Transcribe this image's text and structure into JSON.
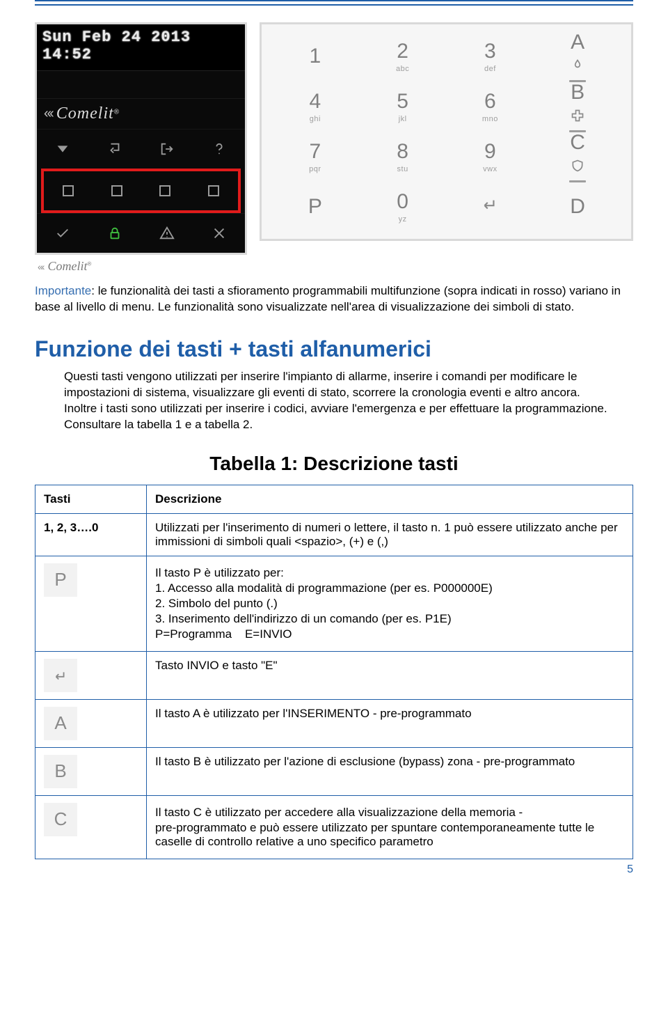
{
  "page_number": "5",
  "lcd": {
    "datetime": "Sun Feb 24 2013 14:52",
    "brand": "Comelit"
  },
  "keypad": {
    "rows": [
      [
        {
          "main": "1",
          "sub": ""
        },
        {
          "main": "2",
          "sub": "abc"
        },
        {
          "main": "3",
          "sub": "def"
        },
        {
          "main": "A",
          "sub": ""
        }
      ],
      [
        {
          "main": "4",
          "sub": "ghi"
        },
        {
          "main": "5",
          "sub": "jkl"
        },
        {
          "main": "6",
          "sub": "mno"
        },
        {
          "main": "B",
          "sub": ""
        }
      ],
      [
        {
          "main": "7",
          "sub": "pqr"
        },
        {
          "main": "8",
          "sub": "stu"
        },
        {
          "main": "9",
          "sub": "vwx"
        },
        {
          "main": "C",
          "sub": ""
        }
      ],
      [
        {
          "main": "P",
          "sub": ""
        },
        {
          "main": "0",
          "sub": "yz"
        },
        {
          "main": "↵",
          "sub": ""
        },
        {
          "main": "D",
          "sub": ""
        }
      ]
    ],
    "side_icons": [
      "fire-icon",
      "bar-icon",
      "medical-icon",
      "bar-icon",
      "shield-icon",
      "bar-icon"
    ]
  },
  "important": {
    "lead": "Importante",
    "text": ": le funzionalità dei tasti a sfioramento programmabili multifunzione (sopra indicati in rosso) variano in base al livello di menu. Le funzionalità sono visualizzate nell'area di visualizzazione dei simboli di stato."
  },
  "section_heading": "Funzione dei tasti + tasti alfanumerici",
  "section_body": "Questi tasti vengono utilizzati per inserire l'impianto di allarme, inserire i comandi per modificare le impostazioni di sistema, visualizzare gli eventi di stato, scorrere la cronologia eventi e altro ancora.\nInoltre i tasti sono utilizzati per inserire i codici, avviare l'emergenza e per effettuare la programmazione. Consultare la tabella 1 e a tabella 2.",
  "table": {
    "title": "Tabella 1: Descrizione tasti",
    "headers": {
      "key": "Tasti",
      "desc": "Descrizione"
    },
    "rows": [
      {
        "key_label": "1, 2, 3….0",
        "key_type": "text",
        "desc": "Utilizzati per l'inserimento di numeri o lettere, il tasto n. 1 può essere utilizzato anche per immissioni di simboli quali <spazio>, (+) e (,)"
      },
      {
        "key_label": "P",
        "key_type": "cap",
        "desc_lines": [
          "Il tasto P è utilizzato per:",
          "1. Accesso alla modalità di programmazione (per es. P000000E)",
          "2. Simbolo del punto (.)",
          "3. Inserimento dell'indirizzo di un comando (per es. P1E)",
          "P=Programma    E=INVIO"
        ]
      },
      {
        "key_label": "enter",
        "key_type": "icon",
        "desc": "Tasto INVIO e tasto \"E\""
      },
      {
        "key_label": "A",
        "key_type": "cap",
        "desc": "Il tasto A è utilizzato per l'INSERIMENTO - pre-programmato"
      },
      {
        "key_label": "B",
        "key_type": "cap",
        "desc": "Il tasto B è utilizzato per l'azione di esclusione (bypass) zona - pre-programmato"
      },
      {
        "key_label": "C",
        "key_type": "cap",
        "desc_lines": [
          "Il tasto C è utilizzato per accedere alla visualizzazione della memoria -",
          "pre-programmato e può essere utilizzato per spuntare contemporaneamente tutte le caselle di controllo relative a uno specifico parametro"
        ]
      }
    ]
  }
}
